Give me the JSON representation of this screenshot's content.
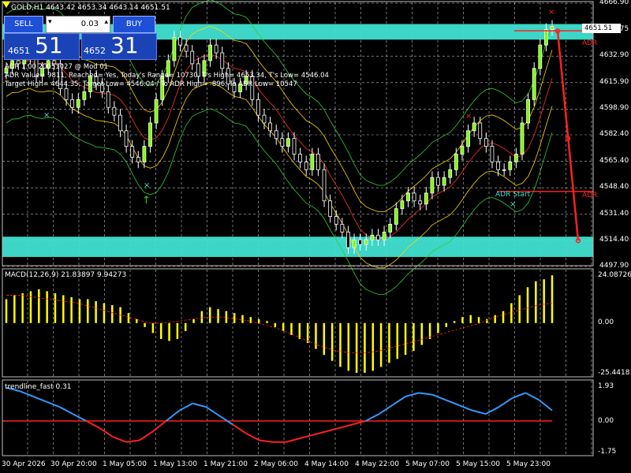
{
  "symbol_line": "GOLD,H1  4643.42 4653.34 4643.14 4651.51",
  "trade_panel": {
    "sell_label": "SELL",
    "buy_label": "BUY",
    "lot": "0.03",
    "sell_small": "4651",
    "sell_big": "51",
    "buy_small": "4652",
    "buy_big": "31"
  },
  "adr_info": [
    "ADR 1.00 20051027 @ Mod 01",
    "ADR Value= 9811, Reached= Yes, Today's Range= 10730, T's High= 4653.34, T's Low= 4546.04",
    "Target High= 4644.35, Target Low= 4546.04 / To ADR High= -896, To ADR Low= 10547"
  ],
  "price_axis": {
    "ticks": [
      "4666.90",
      "4649.75",
      "4632.90",
      "4615.90",
      "4598.90",
      "4582.40",
      "4565.40",
      "4548.40",
      "4531.40",
      "4514.40",
      "4497.90"
    ],
    "current_price": "4651.51"
  },
  "chart_labels": {
    "adr_top": "ADR",
    "adr_mid": "ADR",
    "adr_start": "ADR Start"
  },
  "macd": {
    "title": "MACD(12,26,9) 21.83897 9.94273",
    "ticks": [
      "24.08726",
      "0.00",
      "-25.44181"
    ]
  },
  "trend": {
    "title": "trendline_fast 0.31",
    "ticks": [
      "1.93",
      "0.00",
      "-1.75"
    ]
  },
  "time_axis": [
    "30 Apr 2026",
    "30 Apr 20:00",
    "1 May 05:00",
    "1 May 13:00",
    "1 May 21:00",
    "2 May 06:00",
    "4 May 14:00",
    "4 May 22:00",
    "5 May 07:00",
    "5 May 15:00",
    "5 May 23:00"
  ],
  "colors": {
    "bull": "#ffffff",
    "bear": "#ffffff",
    "bull_fill": "#7cfc00",
    "zone": "#40e0d0",
    "macd_hist": "#ffff00",
    "macd_signal": "#ff2020",
    "trend_up": "#3399ff",
    "trend_down": "#ff2020",
    "adr": "#ff2020"
  },
  "chart_data": [
    {
      "type": "candlestick",
      "title": "GOLD,H1",
      "ylim": [
        4497.9,
        4666.9
      ],
      "close_series": [
        4625,
        4630,
        4628,
        4635,
        4632,
        4620,
        4625,
        4630,
        4628,
        4612,
        4605,
        4600,
        4605,
        4610,
        4620,
        4615,
        4610,
        4600,
        4595,
        4585,
        4575,
        4568,
        4565,
        4575,
        4590,
        4605,
        4620,
        4630,
        4645,
        4640,
        4636,
        4628,
        4620,
        4630,
        4640,
        4635,
        4625,
        4615,
        4610,
        4615,
        4620,
        4605,
        4595,
        4590,
        4585,
        4580,
        4575,
        4580,
        4570,
        4565,
        4560,
        4570,
        4560,
        4540,
        4530,
        4525,
        4520,
        4510,
        4515,
        4512,
        4515,
        4518,
        4515,
        4520,
        4525,
        4535,
        4540,
        4545,
        4540,
        4538,
        4545,
        4555,
        4550,
        4555,
        4560,
        4570,
        4575,
        4585,
        4590,
        4580,
        4575,
        4565,
        4560,
        4560,
        4565,
        4570,
        4590,
        4605,
        4625,
        4640,
        4650,
        4652
      ]
    },
    {
      "type": "bar",
      "title": "MACD(12,26,9)",
      "ylim": [
        -25.44181,
        24.08726
      ],
      "values": [
        12,
        14,
        15,
        16,
        17,
        16,
        15,
        14,
        13,
        12,
        12,
        11,
        10,
        9,
        8,
        5,
        2,
        -2,
        -5,
        -8,
        -9,
        -8,
        -4,
        2,
        6,
        8,
        7,
        6,
        5,
        4,
        3,
        2,
        1,
        -2,
        -4,
        -6,
        -8,
        -10,
        -13,
        -16,
        -19,
        -22,
        -24,
        -25,
        -25,
        -24,
        -22,
        -20,
        -18,
        -16,
        -14,
        -11,
        -8,
        -5,
        -2,
        1,
        3,
        4,
        3,
        2,
        4,
        6,
        10,
        14,
        18,
        21,
        22,
        24
      ],
      "signal": [
        14,
        14,
        13,
        12,
        11,
        10,
        8,
        6,
        4,
        2,
        0,
        0,
        1,
        2,
        3,
        3,
        2,
        1,
        -1,
        -3,
        -6,
        -9,
        -12,
        -14,
        -15,
        -15,
        -14,
        -12,
        -10,
        -8,
        -6,
        -4,
        -2,
        0,
        3,
        5,
        7,
        9,
        10
      ],
      "signal_x_start": 0.22
    },
    {
      "type": "line",
      "title": "trendline_fast",
      "ylim": [
        -1.75,
        1.93
      ],
      "values": [
        1.9,
        1.7,
        1.4,
        1.1,
        0.8,
        0.4,
        0.0,
        -0.4,
        -0.9,
        -1.2,
        -1.1,
        -0.6,
        0.0,
        0.6,
        1.0,
        0.8,
        0.3,
        -0.2,
        -0.7,
        -1.1,
        -1.2,
        -1.2,
        -1.0,
        -0.8,
        -0.6,
        -0.4,
        -0.2,
        0.0,
        0.4,
        0.9,
        1.4,
        1.6,
        1.5,
        1.2,
        0.9,
        0.6,
        0.4,
        0.8,
        1.3,
        1.6,
        1.2,
        0.6
      ]
    }
  ]
}
